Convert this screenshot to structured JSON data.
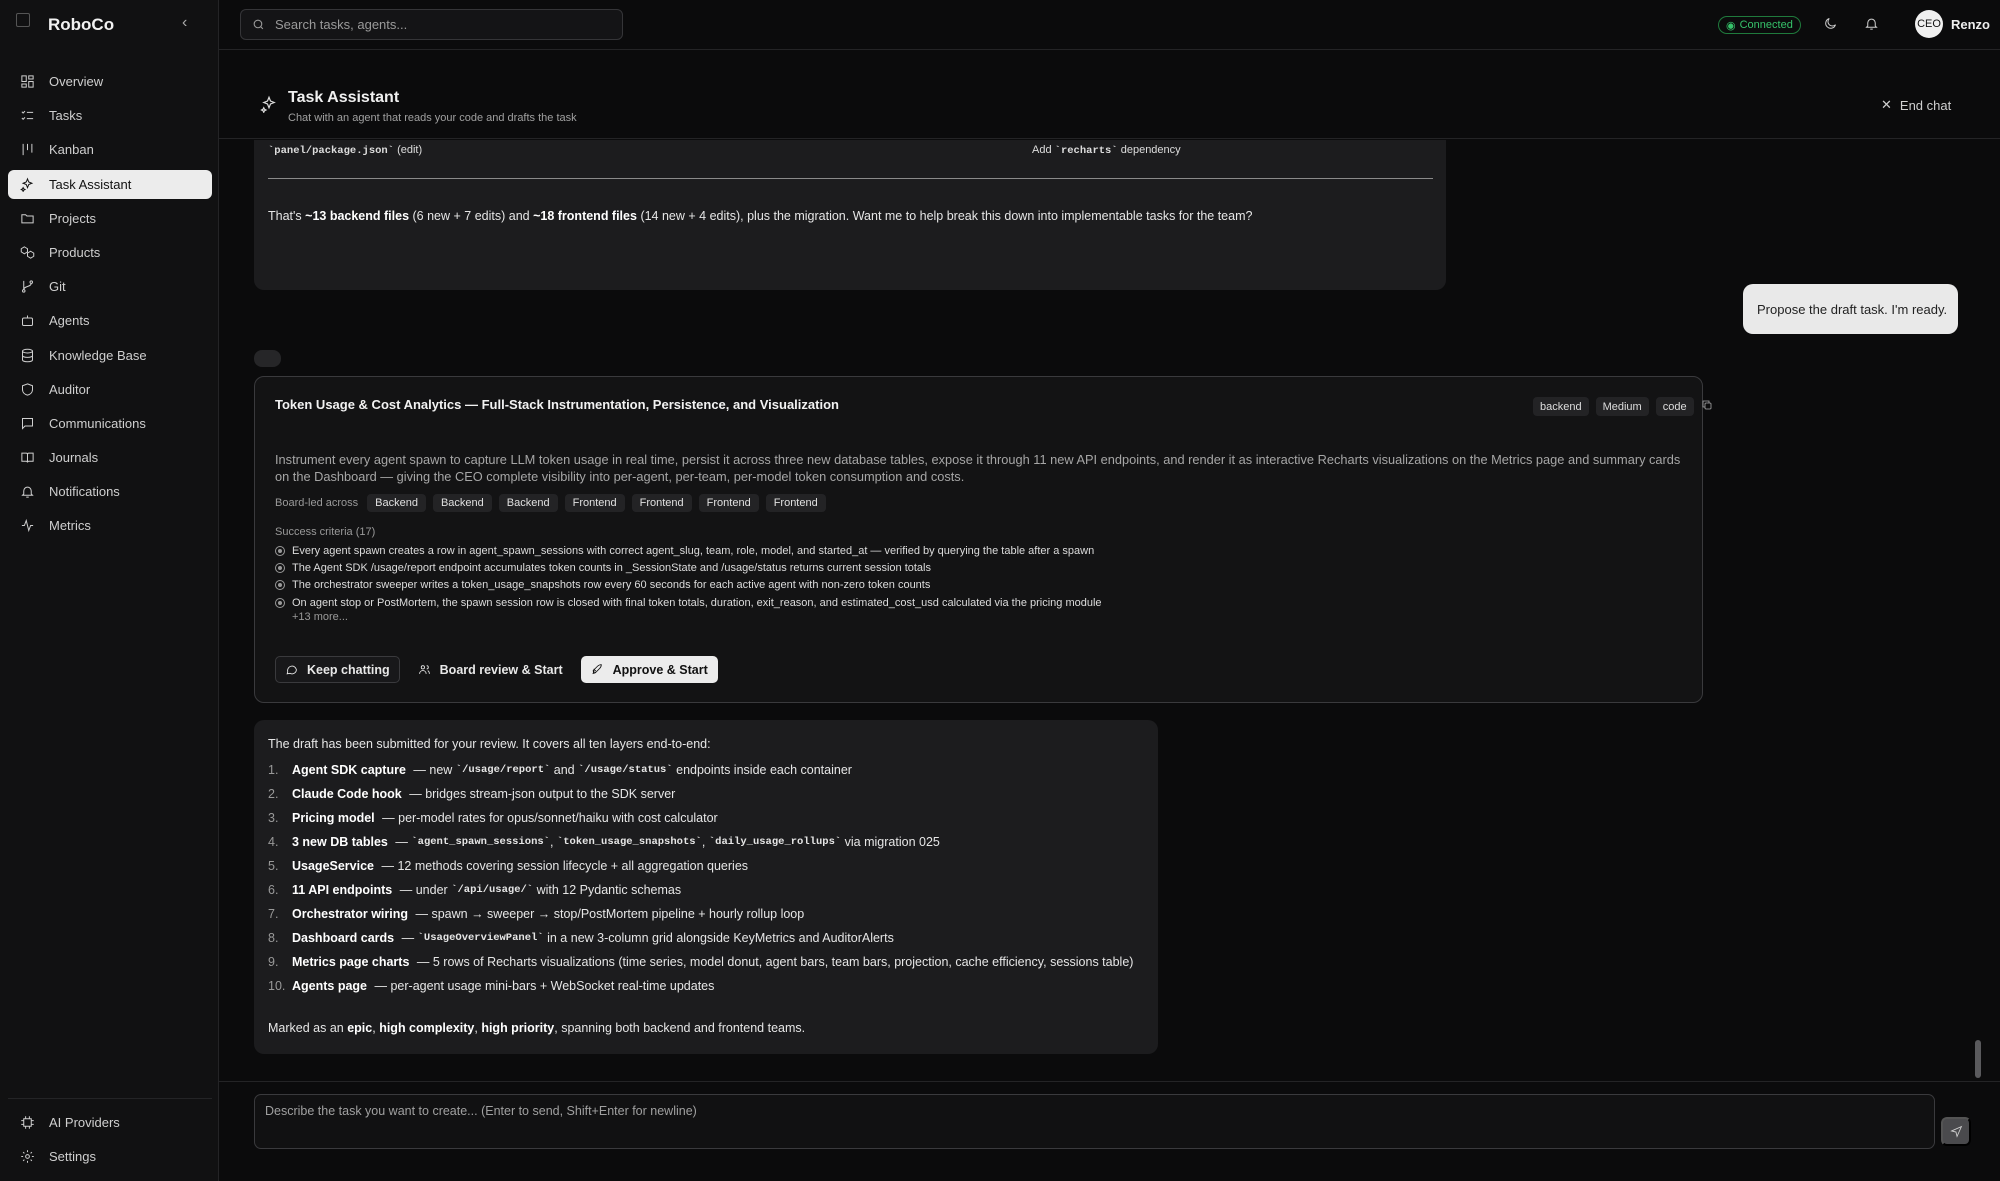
{
  "brand": {
    "name": "RoboCo"
  },
  "sidebar": {
    "items": [
      {
        "label": "Overview",
        "icon": "grid-icon",
        "active": false
      },
      {
        "label": "Tasks",
        "icon": "list-checks-icon",
        "active": false
      },
      {
        "label": "Kanban",
        "icon": "kanban-icon",
        "active": false
      },
      {
        "label": "Task Assistant",
        "icon": "sparkles-icon",
        "active": true
      },
      {
        "label": "Projects",
        "icon": "folder-icon",
        "active": false
      },
      {
        "label": "Products",
        "icon": "boxes-icon",
        "active": false
      },
      {
        "label": "Git",
        "icon": "git-branch-icon",
        "active": false
      },
      {
        "label": "Agents",
        "icon": "bot-icon",
        "active": false
      },
      {
        "label": "Knowledge Base",
        "icon": "database-icon",
        "active": false
      },
      {
        "label": "Auditor",
        "icon": "shield-icon",
        "active": false
      },
      {
        "label": "Communications",
        "icon": "message-square-icon",
        "active": false
      },
      {
        "label": "Journals",
        "icon": "book-icon",
        "active": false
      },
      {
        "label": "Notifications",
        "icon": "bell-icon",
        "active": false
      },
      {
        "label": "Metrics",
        "icon": "activity-icon",
        "active": false
      }
    ],
    "bottom": [
      {
        "label": "AI Providers",
        "icon": "cpu-icon"
      },
      {
        "label": "Settings",
        "icon": "gear-icon"
      }
    ]
  },
  "topbar": {
    "search_placeholder": "Search tasks, agents...",
    "status": "Connected",
    "user_initials": "CEO",
    "user_name": "Renzo"
  },
  "chat": {
    "title": "Task Assistant",
    "subtitle": "Chat with an agent that reads your code and drafts the task",
    "end_label": "End chat"
  },
  "prev_message": {
    "file": "`panel/package.json`",
    "file_action": "(edit)",
    "change_pre": "Add",
    "change_code": "`recharts`",
    "change_post": "dependency",
    "summary_1": "That's",
    "summary_b1": "~13 backend files",
    "summary_2": "(6 new + 7 edits) and",
    "summary_b2": "~18 frontend files",
    "summary_3": "(14 new + 4 edits), plus the migration. Want me to help break this down into implementable tasks for the team?"
  },
  "user_message": "Propose the draft task. I'm ready.",
  "draft": {
    "title": "Token Usage & Cost Analytics — Full-Stack Instrumentation, Persistence, and Visualization",
    "tags": [
      "backend",
      "Medium",
      "code"
    ],
    "description": "Instrument every agent spawn to capture LLM token usage in real time, persist it across three new database tables, expose it through 11 new API endpoints, and render it as interactive Recharts visualizations on the Metrics page and summary cards on the Dashboard — giving the CEO complete visibility into per-agent, per-team, per-model token consumption and costs.",
    "board_label": "Board-led across",
    "board_chips": [
      "Backend",
      "Backend",
      "Backend",
      "Frontend",
      "Frontend",
      "Frontend",
      "Frontend"
    ],
    "criteria_label": "Success criteria (17)",
    "criteria": [
      "Every agent spawn creates a row in agent_spawn_sessions with correct agent_slug, team, role, model, and started_at — verified by querying the table after a spawn",
      "The Agent SDK /usage/report endpoint accumulates token counts in _SessionState and /usage/status returns current session totals",
      "The orchestrator sweeper writes a token_usage_snapshots row every 60 seconds for each active agent with non-zero token counts",
      "On agent stop or PostMortem, the spawn session row is closed with final token totals, duration, exit_reason, and estimated_cost_usd calculated via the pricing module"
    ],
    "more": "+13 more...",
    "btn_keep": "Keep chatting",
    "btn_board": "Board review & Start",
    "btn_approve": "Approve & Start"
  },
  "reply": {
    "intro": "The draft has been submitted for your review. It covers all ten layers end-to-end:",
    "items": [
      {
        "n": "1.",
        "b": "Agent SDK capture",
        "t1": "— new",
        "c1": "`/usage/report`",
        "t2": "and",
        "c2": "`/usage/status`",
        "t3": "endpoints inside each container"
      },
      {
        "n": "2.",
        "b": "Claude Code hook",
        "t1": "— bridges stream-json output to the SDK server"
      },
      {
        "n": "3.",
        "b": "Pricing model",
        "t1": "— per-model rates for opus/sonnet/haiku with cost calculator"
      },
      {
        "n": "4.",
        "b": "3 new DB tables",
        "t1": "—",
        "c1": "`agent_spawn_sessions`",
        "t2": ",",
        "c2": "`token_usage_snapshots`",
        "t3": ",",
        "c3": "`daily_usage_rollups`",
        "t4": "via migration 025"
      },
      {
        "n": "5.",
        "b": "UsageService",
        "t1": "— 12 methods covering session lifecycle + all aggregation queries"
      },
      {
        "n": "6.",
        "b": "11 API endpoints",
        "t1": "— under",
        "c1": "`/api/usage/`",
        "t2": "with 12 Pydantic schemas"
      },
      {
        "n": "7.",
        "b": "Orchestrator wiring",
        "t1": "— spawn → sweeper → stop/PostMortem pipeline + hourly rollup loop"
      },
      {
        "n": "8.",
        "b": "Dashboard cards",
        "t1": "—",
        "c1": "`UsageOverviewPanel`",
        "t2": "in a new 3-column grid alongside KeyMetrics and AuditorAlerts"
      },
      {
        "n": "9.",
        "b": "Metrics page charts",
        "t1": "— 5 rows of Recharts visualizations (time series, model donut, agent bars, team bars, projection, cache efficiency, sessions table)"
      },
      {
        "n": "10.",
        "b": "Agents page",
        "t1": "— per-agent usage mini-bars + WebSocket real-time updates"
      }
    ],
    "outro_1": "Marked as an",
    "outro_b1": "epic",
    "outro_2": ",",
    "outro_b2": "high complexity",
    "outro_3": ",",
    "outro_b3": "high priority",
    "outro_4": ", spanning both backend and frontend teams."
  },
  "composer": {
    "placeholder": "Describe the task you want to create... (Enter to send, Shift+Enter for newline)"
  }
}
